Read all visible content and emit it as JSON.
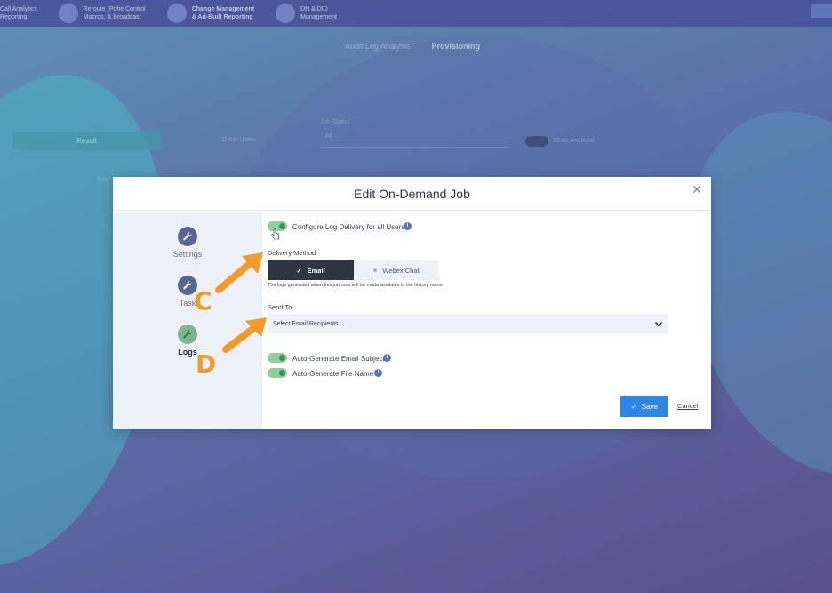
{
  "background": {
    "top_nav": [
      {
        "line1": "Call Analytics",
        "line2": "Reporting"
      },
      {
        "line1": "Reroute (Pohe Control",
        "line2": "Macros, & Broadcast"
      },
      {
        "line1": "Change Management",
        "line2": "& Ad-Built Reporting"
      },
      {
        "line1": "DN & DID",
        "line2": "Management"
      }
    ],
    "subtabs": [
      "Audit Log Analysis",
      "Provisioning"
    ],
    "active_subtab": "Provisioning",
    "button_label": "Result",
    "users_label": "Other Users",
    "job_status_label": "Job Status",
    "job_status_value": "All",
    "toggle_label": "Show Archived",
    "table_header": "Tem"
  },
  "modal": {
    "title": "Edit On-Demand Job",
    "close_icon": "close-icon",
    "sidebar": [
      {
        "label": "Settings",
        "icon": "wrench-icon"
      },
      {
        "label": "Task",
        "icon": "wrench-icon"
      },
      {
        "label": "Logs",
        "icon": "wrench-icon",
        "active": true
      }
    ],
    "configure_log_label": "Configure Log Delivery for all Users",
    "delivery_method_label": "Delivery Method",
    "delivery_options": [
      "Email",
      "Webex Chat"
    ],
    "delivery_selected": "Email",
    "delivery_helper": "The logs generated when this job runs will be made available in the history menu",
    "send_to_label": "Send To",
    "send_to_placeholder": "Select Email Recipients...",
    "auto_subject_label": "Auto-Generate Email Subject",
    "auto_filename_label": "Auto-Generate File Name",
    "save_label": "Save",
    "cancel_label": "Cancel"
  },
  "annotations": [
    "C",
    "D"
  ],
  "colors": {
    "accent": "#2f86e8",
    "toggle_on": "#8fcf99",
    "segment_active": "#2f3447",
    "annotation": "#f39a2c"
  }
}
